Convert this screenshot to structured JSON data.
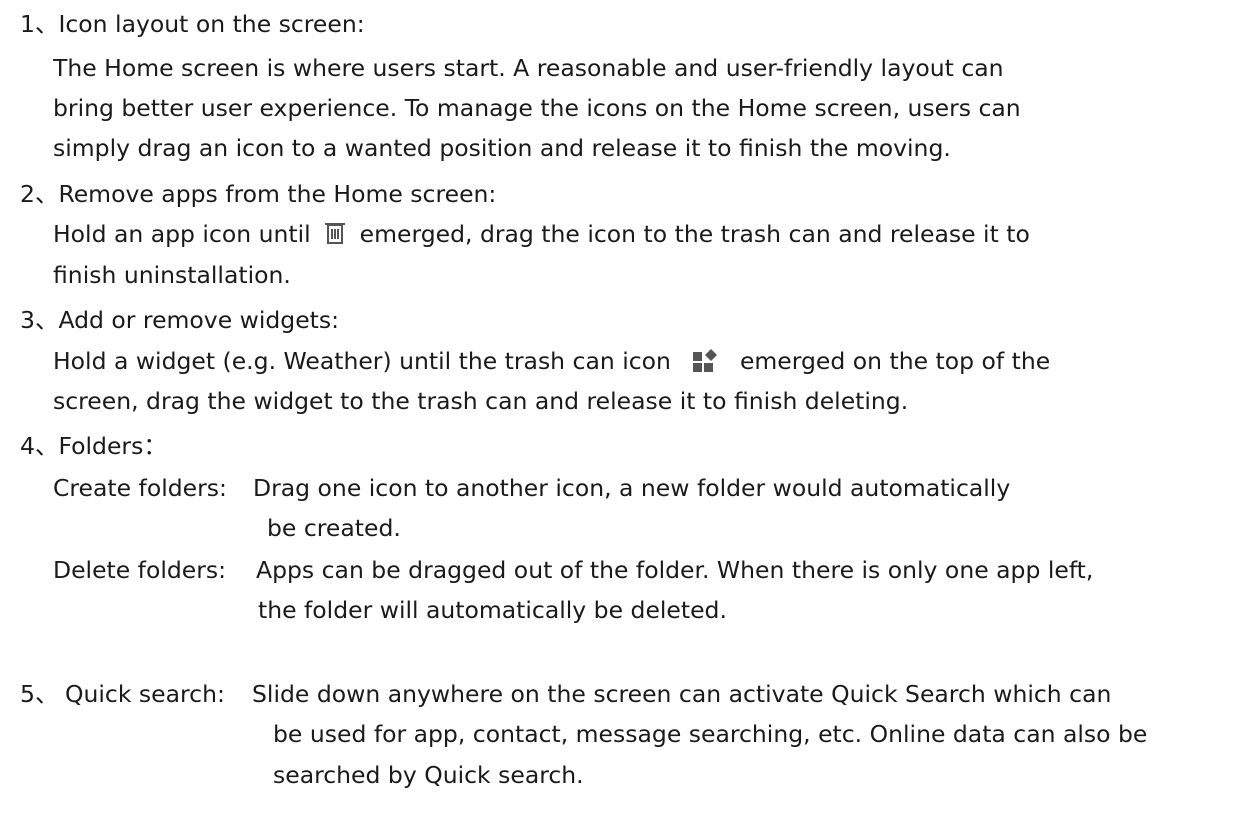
{
  "sections": [
    {
      "number": "1、",
      "heading": "Icon layout on the screen:",
      "lines": [
        "The Home screen is where users start. A reasonable and user-friendly layout can",
        "bring better user experience. To manage the icons on the Home screen, users can",
        "simply drag an icon to a wanted position and release it to finish the moving."
      ]
    },
    {
      "number": "2、",
      "heading": "Remove apps from the Home screen:",
      "line1_before_icon": "Hold an app icon until",
      "line1_icon": "trash-can-icon",
      "line1_after_icon": "emerged, drag the icon to the trash can and release it to",
      "line2": "finish uninstallation."
    },
    {
      "number": "3、",
      "heading": "Add or remove widgets:",
      "line1_before_icon": "Hold a widget (e.g. Weather) until the trash can icon",
      "line1_icon": "widgets-icon",
      "line1_after_icon": "emerged on the top of the",
      "line2": "screen, drag the widget to the trash can and release it to finish deleting."
    },
    {
      "number": "4、",
      "heading": "Folders：",
      "create_label": "Create folders:",
      "create_line1": "Drag one icon to another icon, a new folder would automatically",
      "create_line2": "be created.",
      "delete_label": "Delete folders:",
      "delete_line1": "Apps can be dragged out of the folder. When there is only one app left,",
      "delete_line2": "the folder will automatically be deleted."
    },
    {
      "number": "5、",
      "label": "Quick search:",
      "line1": "Slide down anywhere on the screen can activate Quick Search which can",
      "line2": "be used for app, contact, message searching, etc. Online data can also be",
      "line3": "searched by Quick search."
    }
  ],
  "colors": {
    "text": "#1a1a1a",
    "icon": "#555555",
    "background": "#ffffff"
  }
}
